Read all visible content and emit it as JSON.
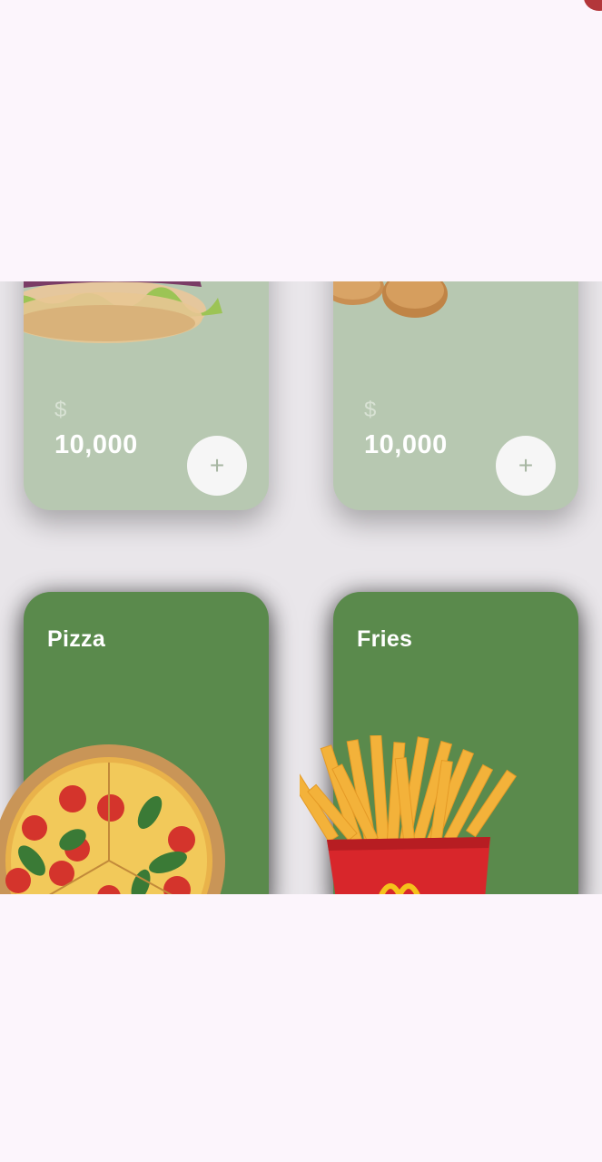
{
  "cards": [
    {
      "currency": "$",
      "price": "10,000",
      "add_icon": "plus-icon"
    },
    {
      "currency": "$",
      "price": "10,000",
      "add_icon": "plus-icon"
    },
    {
      "title": "Pizza"
    },
    {
      "title": "Fries"
    }
  ],
  "colors": {
    "card_active": "#5a8a4c",
    "card_faded": "#b7c8b1",
    "background": "#fcf5fc",
    "accent": "#b3363a"
  }
}
